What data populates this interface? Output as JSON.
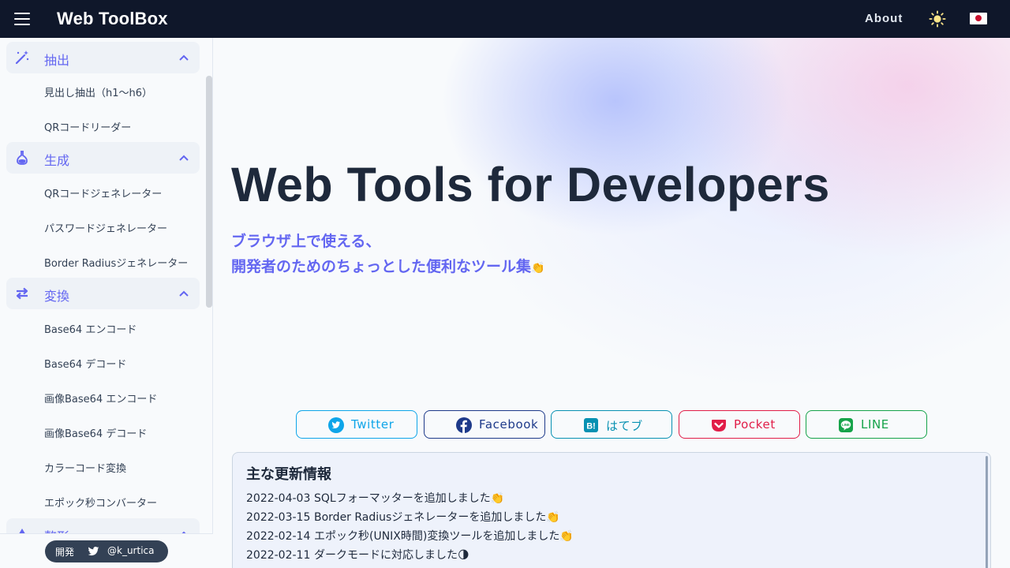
{
  "header": {
    "title": "Web ToolBox",
    "about_label": "About",
    "icons": [
      "menu-icon",
      "sun-icon",
      "japan-flag-icon"
    ]
  },
  "sidebar": {
    "categories": [
      {
        "label": "抽出",
        "icon": "magic-wand-icon",
        "items": [
          "見出し抽出（h1〜h6）",
          "QRコードリーダー"
        ]
      },
      {
        "label": "生成",
        "icon": "flask-icon",
        "items": [
          "QRコードジェネレーター",
          "パスワードジェネレーター",
          "Border Radiusジェネレーター"
        ]
      },
      {
        "label": "変換",
        "icon": "swap-icon",
        "items": [
          "Base64 エンコード",
          "Base64 デコード",
          "画像Base64 エンコード",
          "画像Base64 デコード",
          "カラーコード変換",
          "エポック秒コンバーター"
        ]
      },
      {
        "label": "整形",
        "icon": "format-icon",
        "items": []
      }
    ],
    "footer": {
      "dev_label": "開発",
      "handle": "@k_urtica"
    }
  },
  "hero": {
    "title": "Web Tools for Developers",
    "subtitle_line1": "ブラウザ上で使える、",
    "subtitle_line2": "開発者のためのちょっとした便利なツール集",
    "subtitle_emoji": "👏"
  },
  "share": [
    {
      "label": "Twitter",
      "icon": "twitter-icon",
      "color": "#0ea5e9"
    },
    {
      "label": "Facebook",
      "icon": "facebook-icon",
      "color": "#1e3a8a"
    },
    {
      "label": "はてブ",
      "icon": "hatena-icon",
      "color": "#0891b2"
    },
    {
      "label": "Pocket",
      "icon": "pocket-icon",
      "color": "#e11d48"
    },
    {
      "label": "LINE",
      "icon": "line-icon",
      "color": "#16a34a"
    }
  ],
  "news": {
    "title": "主な更新情報",
    "items": [
      {
        "date": "2022-04-03",
        "text": "SQLフォーマッターを追加しました",
        "emoji": "👏"
      },
      {
        "date": "2022-03-15",
        "text": "Border Radiusジェネレーターを追加しました",
        "emoji": "👏"
      },
      {
        "date": "2022-02-14",
        "text": "エポック秒(UNIX時間)変換ツールを追加しました",
        "emoji": "👏"
      },
      {
        "date": "2022-02-11",
        "text": "ダークモードに対応しました",
        "emoji": "🌗"
      }
    ]
  }
}
